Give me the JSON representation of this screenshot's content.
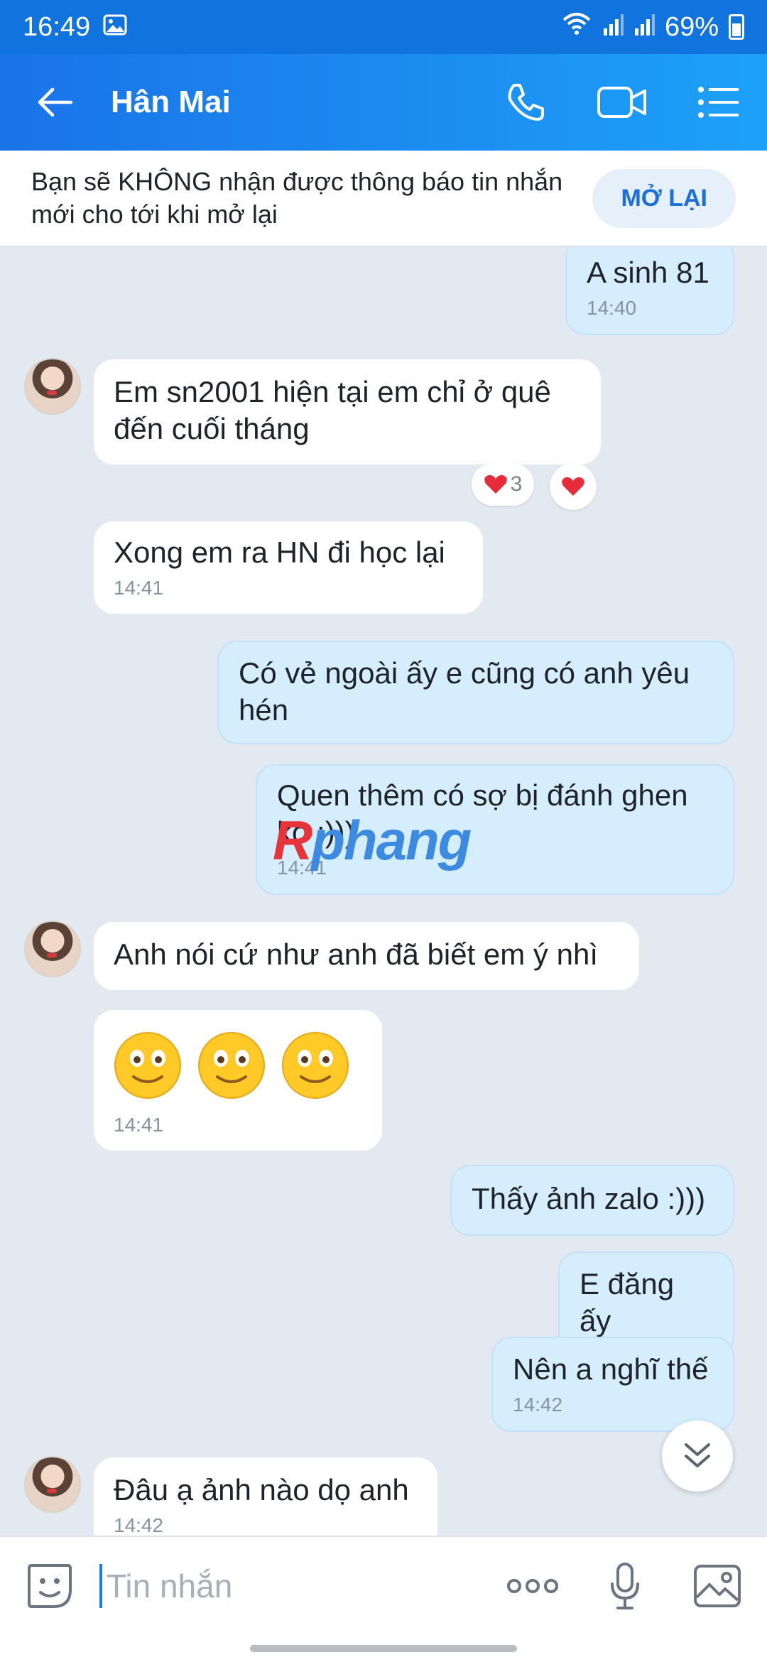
{
  "status_bar": {
    "time": "16:49",
    "battery": "69%"
  },
  "header": {
    "contact_name": "Hân Mai"
  },
  "notice": {
    "text": "Bạn sẽ KHÔNG nhận được thông báo tin nhắn mới cho tới khi mở lại",
    "button": "MỞ LẠI"
  },
  "messages": [
    {
      "dir": "out",
      "text": "A sinh 81",
      "time": "14:40"
    },
    {
      "dir": "in",
      "text": "Em sn2001 hiện tại em chỉ ở quê đến cuối tháng",
      "reactions": {
        "count": "3"
      }
    },
    {
      "dir": "in",
      "text": "Xong em ra HN đi học lại",
      "time": "14:41"
    },
    {
      "dir": "out",
      "text": "Có vẻ ngoài ấy e cũng có anh yêu hén"
    },
    {
      "dir": "out",
      "text": "Quen thêm có sợ bị đánh ghen ko :)))",
      "time": "14:41"
    },
    {
      "dir": "in",
      "text": "Anh nói cứ như anh đã biết em ý nhì"
    },
    {
      "dir": "in",
      "type": "emoji",
      "emoji": [
        "smiley-face",
        "smiley-face",
        "smiley-face"
      ],
      "time": "14:41"
    },
    {
      "dir": "out",
      "text": "Thấy ảnh zalo :)))"
    },
    {
      "dir": "out",
      "text": "E đăng ấy"
    },
    {
      "dir": "out",
      "text": "Nên a nghĩ thế",
      "time": "14:42"
    },
    {
      "dir": "in",
      "text": "Đâu ạ ảnh nào dọ anh",
      "time": "14:42"
    }
  ],
  "watermark": {
    "part1": "R",
    "part2": "phang"
  },
  "input": {
    "placeholder": "Tin nhắn"
  },
  "colors": {
    "header_start": "#1a73e8",
    "header_end": "#1da1f8",
    "outgoing_bubble": "#d5eefe",
    "incoming_bubble": "#ffffff",
    "chat_background": "#e2e9f1",
    "accent": "#1b6fd8"
  }
}
